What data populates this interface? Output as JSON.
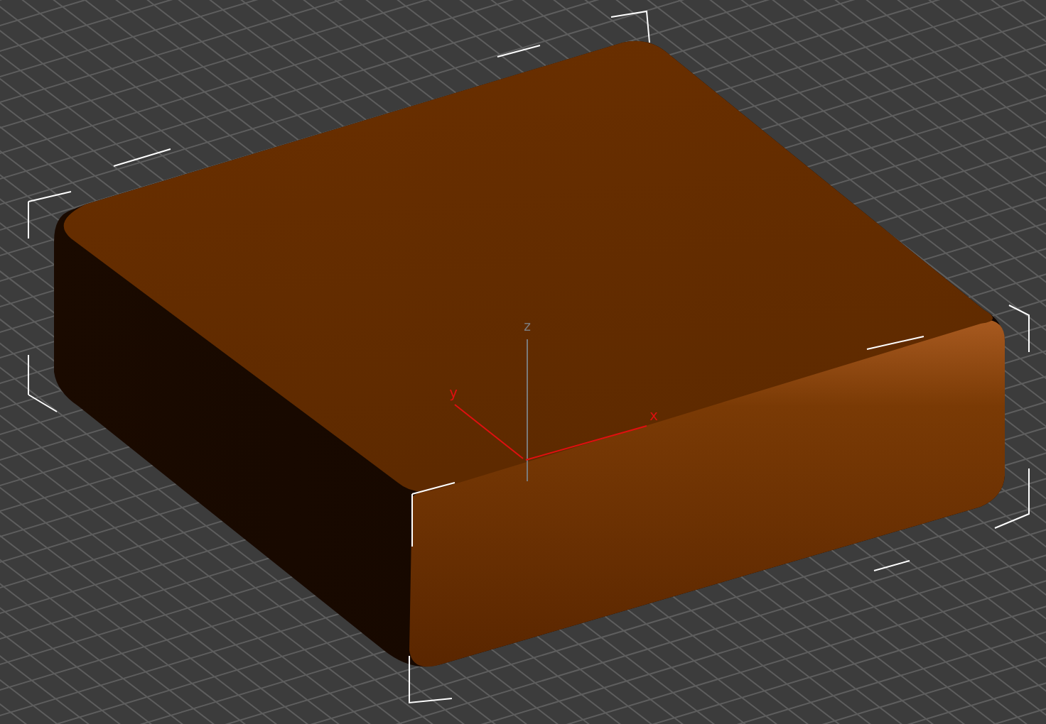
{
  "viewport": {
    "axes": [
      {
        "label": "z",
        "color": "#7a7a7a"
      },
      {
        "label": "y",
        "color": "#e01010"
      },
      {
        "label": "x",
        "color": "#e01010"
      }
    ]
  }
}
